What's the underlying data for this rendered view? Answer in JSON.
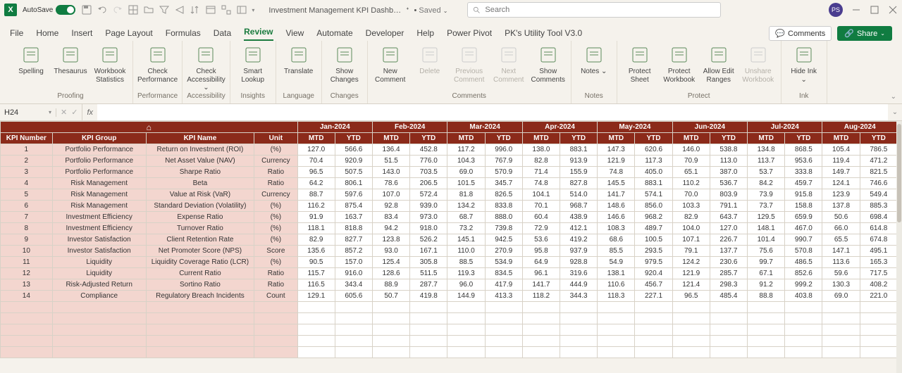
{
  "topbar": {
    "autosave_label": "AutoSave",
    "autosave_state": "On",
    "doc_title": "Investment Management KPI Dashb…",
    "saved_label": "Saved",
    "search_placeholder": "Search",
    "avatar_initials": "PS"
  },
  "tabs": {
    "items": [
      "File",
      "Home",
      "Insert",
      "Page Layout",
      "Formulas",
      "Data",
      "Review",
      "View",
      "Automate",
      "Developer",
      "Help",
      "Power Pivot",
      "PK's Utility Tool V3.0"
    ],
    "active_index": 6,
    "comments_label": "Comments",
    "share_label": "Share"
  },
  "ribbon": {
    "groups": [
      {
        "label": "Proofing",
        "items": [
          {
            "t": "Spelling"
          },
          {
            "t": "Thesaurus"
          },
          {
            "t": "Workbook Statistics"
          }
        ]
      },
      {
        "label": "Performance",
        "items": [
          {
            "t": "Check Performance"
          }
        ]
      },
      {
        "label": "Accessibility",
        "items": [
          {
            "t": "Check Accessibility ⌄"
          }
        ]
      },
      {
        "label": "Insights",
        "items": [
          {
            "t": "Smart Lookup"
          }
        ]
      },
      {
        "label": "Language",
        "items": [
          {
            "t": "Translate"
          }
        ]
      },
      {
        "label": "Changes",
        "items": [
          {
            "t": "Show Changes"
          }
        ]
      },
      {
        "label": "Comments",
        "items": [
          {
            "t": "New Comment"
          },
          {
            "t": "Delete",
            "d": true
          },
          {
            "t": "Previous Comment",
            "d": true
          },
          {
            "t": "Next Comment",
            "d": true
          },
          {
            "t": "Show Comments"
          }
        ]
      },
      {
        "label": "Notes",
        "items": [
          {
            "t": "Notes ⌄"
          }
        ]
      },
      {
        "label": "Protect",
        "items": [
          {
            "t": "Protect Sheet"
          },
          {
            "t": "Protect Workbook"
          },
          {
            "t": "Allow Edit Ranges"
          },
          {
            "t": "Unshare Workbook",
            "d": true
          }
        ]
      },
      {
        "label": "Ink",
        "items": [
          {
            "t": "Hide Ink ⌄"
          }
        ]
      }
    ]
  },
  "formula_bar": {
    "namebox": "H24"
  },
  "sheet": {
    "months": [
      "Jan-2024",
      "Feb-2024",
      "Mar-2024",
      "Apr-2024",
      "May-2024",
      "Jun-2024",
      "Jul-2024",
      "Aug-2024"
    ],
    "headers_left": [
      "KPI Number",
      "KPI Group",
      "KPI Name",
      "Unit"
    ],
    "mtd": "MTD",
    "ytd": "YTD",
    "rows": [
      {
        "n": 1,
        "g": "Portfolio Performance",
        "name": "Return on Investment (ROI)",
        "u": "(%)",
        "v": [
          127.0,
          566.6,
          136.4,
          452.8,
          117.2,
          996.0,
          138.0,
          883.1,
          147.3,
          620.6,
          146.0,
          538.8,
          134.8,
          868.5,
          105.4,
          786.5
        ]
      },
      {
        "n": 2,
        "g": "Portfolio Performance",
        "name": "Net Asset Value (NAV)",
        "u": "Currency",
        "v": [
          70.4,
          920.9,
          51.5,
          776.0,
          104.3,
          767.9,
          82.8,
          913.9,
          121.9,
          117.3,
          70.9,
          113.0,
          113.7,
          953.6,
          119.4,
          471.2
        ]
      },
      {
        "n": 3,
        "g": "Portfolio Performance",
        "name": "Sharpe Ratio",
        "u": "Ratio",
        "v": [
          96.5,
          507.5,
          143.0,
          703.5,
          69.0,
          570.9,
          71.4,
          155.9,
          74.8,
          405.0,
          65.1,
          387.0,
          53.7,
          333.8,
          149.7,
          821.5
        ]
      },
      {
        "n": 4,
        "g": "Risk Management",
        "name": "Beta",
        "u": "Ratio",
        "v": [
          64.2,
          806.1,
          78.6,
          206.5,
          101.5,
          345.7,
          74.8,
          827.8,
          145.5,
          883.1,
          110.2,
          536.7,
          84.2,
          459.7,
          124.1,
          746.6
        ]
      },
      {
        "n": 5,
        "g": "Risk Management",
        "name": "Value at Risk (VaR)",
        "u": "Currency",
        "v": [
          88.7,
          597.6,
          107.0,
          572.4,
          81.8,
          826.5,
          104.1,
          514.0,
          141.7,
          574.1,
          70.0,
          803.9,
          73.9,
          915.8,
          123.9,
          549.4
        ]
      },
      {
        "n": 6,
        "g": "Risk Management",
        "name": "Standard Deviation (Volatility)",
        "u": "(%)",
        "v": [
          116.2,
          875.4,
          92.8,
          939.0,
          134.2,
          833.8,
          70.1,
          968.7,
          148.6,
          856.0,
          103.3,
          791.1,
          73.7,
          158.8,
          137.8,
          885.3
        ]
      },
      {
        "n": 7,
        "g": "Investment Efficiency",
        "name": "Expense Ratio",
        "u": "(%)",
        "v": [
          91.9,
          163.7,
          83.4,
          973.0,
          68.7,
          888.0,
          60.4,
          438.9,
          146.6,
          968.2,
          82.9,
          643.7,
          129.5,
          659.9,
          50.6,
          698.4
        ]
      },
      {
        "n": 8,
        "g": "Investment Efficiency",
        "name": "Turnover Ratio",
        "u": "(%)",
        "v": [
          118.1,
          818.8,
          94.2,
          918.0,
          73.2,
          739.8,
          72.9,
          412.1,
          108.3,
          489.7,
          104.0,
          127.0,
          148.1,
          467.0,
          66.0,
          614.8
        ]
      },
      {
        "n": 9,
        "g": "Investor Satisfaction",
        "name": "Client Retention Rate",
        "u": "(%)",
        "v": [
          82.9,
          827.7,
          123.8,
          526.2,
          145.1,
          942.5,
          53.6,
          419.2,
          68.6,
          100.5,
          107.1,
          226.7,
          101.4,
          990.7,
          65.5,
          674.8
        ]
      },
      {
        "n": 10,
        "g": "Investor Satisfaction",
        "name": "Net Promoter Score (NPS)",
        "u": "Score",
        "v": [
          135.6,
          857.2,
          93.0,
          167.1,
          110.0,
          270.9,
          95.8,
          937.9,
          85.5,
          293.5,
          79.1,
          137.7,
          75.6,
          570.8,
          147.1,
          495.1
        ]
      },
      {
        "n": 11,
        "g": "Liquidity",
        "name": "Liquidity Coverage Ratio (LCR)",
        "u": "(%)",
        "v": [
          90.5,
          157.0,
          125.4,
          305.8,
          88.5,
          534.9,
          64.9,
          928.8,
          54.9,
          979.5,
          124.2,
          230.6,
          99.7,
          486.5,
          113.6,
          165.3
        ]
      },
      {
        "n": 12,
        "g": "Liquidity",
        "name": "Current Ratio",
        "u": "Ratio",
        "v": [
          115.7,
          916.0,
          128.6,
          511.5,
          119.3,
          834.5,
          96.1,
          319.6,
          138.1,
          920.4,
          121.9,
          285.7,
          67.1,
          852.6,
          59.6,
          717.5
        ]
      },
      {
        "n": 13,
        "g": "Risk-Adjusted Return",
        "name": "Sortino Ratio",
        "u": "Ratio",
        "v": [
          116.5,
          343.4,
          88.9,
          287.7,
          96.0,
          417.9,
          141.7,
          444.9,
          110.6,
          456.7,
          121.4,
          298.3,
          91.2,
          999.2,
          130.3,
          408.2
        ]
      },
      {
        "n": 14,
        "g": "Compliance",
        "name": "Regulatory Breach Incidents",
        "u": "Count",
        "v": [
          129.1,
          605.6,
          50.7,
          419.8,
          144.9,
          413.3,
          118.2,
          344.3,
          118.3,
          227.1,
          96.5,
          485.4,
          88.8,
          403.8,
          69.0,
          221.0
        ]
      }
    ]
  }
}
